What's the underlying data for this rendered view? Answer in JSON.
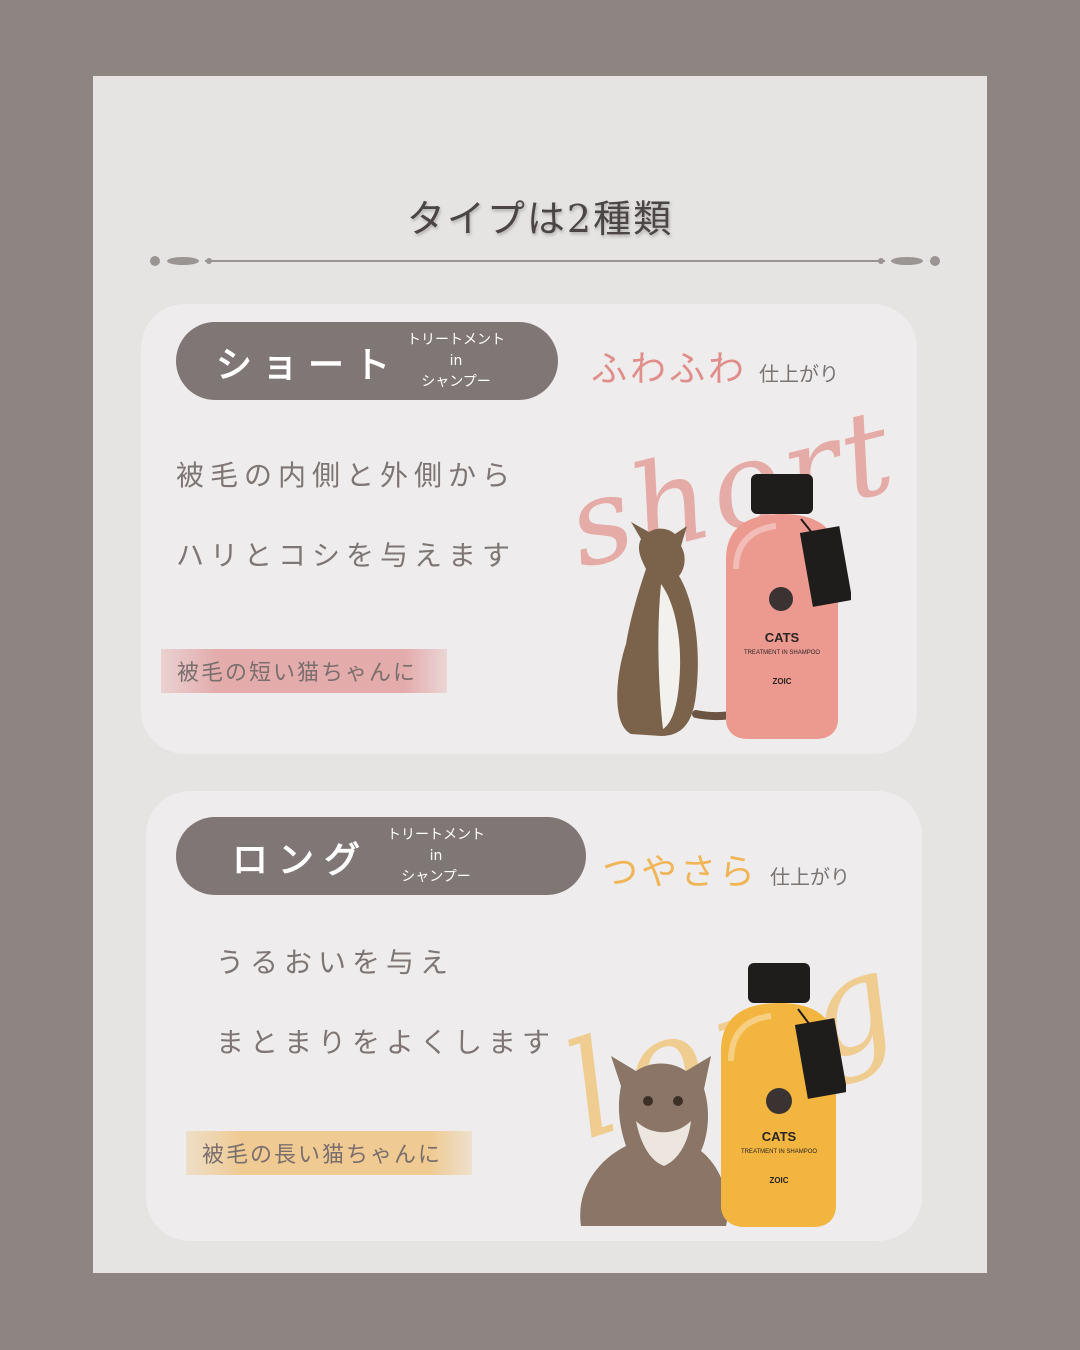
{
  "title": "タイプは2種類",
  "short": {
    "name": "ショート",
    "sub": [
      "トリートメント",
      "in",
      "シャンプー"
    ],
    "finish_big": "ふわふわ",
    "finish_small": "仕上がり",
    "lines": [
      "被毛の内側と外側から",
      "ハリとコシを与えます"
    ],
    "target": "被毛の短い猫ちゃんに",
    "script": "short",
    "bottle": {
      "brand": "CATS",
      "product": "TREATMENT IN SHAMPOO",
      "maker": "ZOIC",
      "color": "#ec9a90",
      "cat_icon": "short-hair-cat-illustration"
    }
  },
  "long": {
    "name": "ロング",
    "sub": [
      "トリートメント",
      "in",
      "シャンプー"
    ],
    "finish_big": "つやさら",
    "finish_small": "仕上がり",
    "lines": [
      "うるおいを与え",
      "まとまりをよくします"
    ],
    "target": "被毛の長い猫ちゃんに",
    "script": "long",
    "bottle": {
      "brand": "CATS",
      "product": "TREATMENT IN SHAMPOO",
      "maker": "ZOIC",
      "color": "#f2b540",
      "cat_icon": "long-hair-cat-illustration"
    }
  },
  "colors": {
    "background": "#8c8582",
    "sheet": "#e6e4e3",
    "card": "#eeecec",
    "pill": "#7f7775",
    "short_accent": "#e08e8a",
    "long_accent": "#f0b556"
  }
}
